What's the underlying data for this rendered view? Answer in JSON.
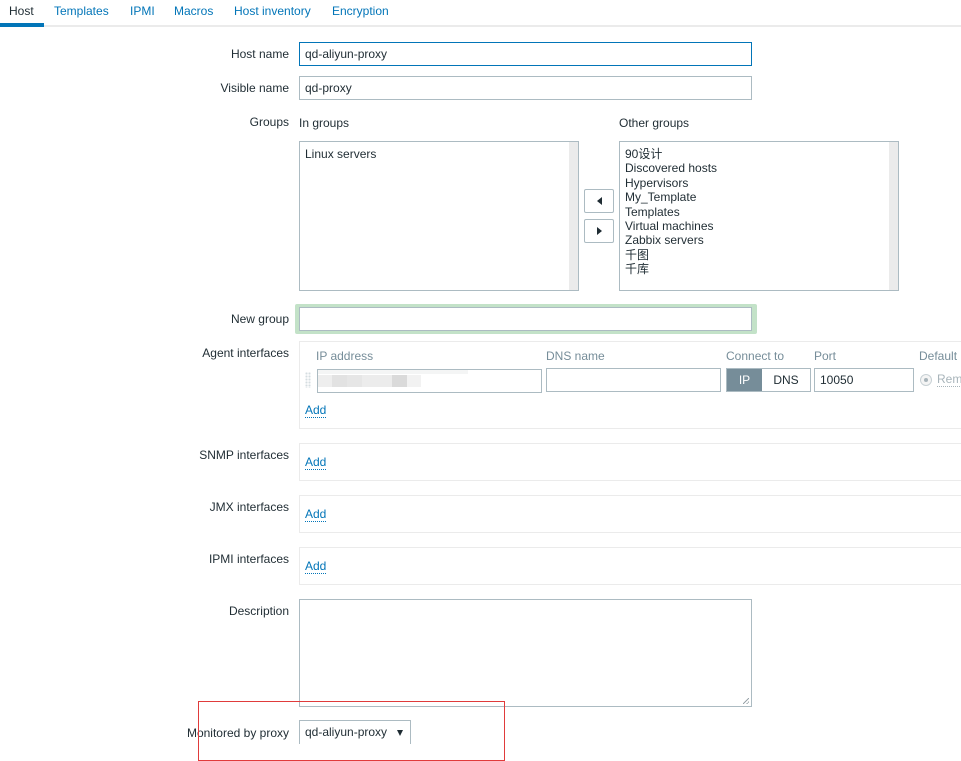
{
  "tabs": [
    {
      "label": "Host",
      "active": true
    },
    {
      "label": "Templates"
    },
    {
      "label": "IPMI"
    },
    {
      "label": "Macros"
    },
    {
      "label": "Host inventory"
    },
    {
      "label": "Encryption"
    }
  ],
  "form": {
    "host_name": {
      "label": "Host name",
      "value": "qd-aliyun-proxy"
    },
    "visible_name": {
      "label": "Visible name",
      "value": "qd-proxy"
    },
    "groups": {
      "label": "Groups",
      "in_groups_label": "In groups",
      "other_groups_label": "Other groups",
      "in_groups": [
        "Linux servers"
      ],
      "other_groups": [
        "90设计",
        "Discovered hosts",
        "Hypervisors",
        "My_Template",
        "Templates",
        "Virtual machines",
        "Zabbix servers",
        "千图",
        "千库"
      ],
      "move_left_icon": "triangle-left",
      "move_right_icon": "triangle-right"
    },
    "new_group": {
      "label": "New group",
      "value": ""
    },
    "agent_interfaces": {
      "label": "Agent interfaces",
      "columns": {
        "ip": "IP address",
        "dns": "DNS name",
        "connect": "Connect to",
        "port": "Port",
        "default": "Default"
      },
      "row": {
        "ip": "",
        "dns": "",
        "connect_options": [
          "IP",
          "DNS"
        ],
        "connect_selected": "IP",
        "port": "10050",
        "remove_label": "Rem"
      },
      "add_label": "Add"
    },
    "snmp_interfaces": {
      "label": "SNMP interfaces",
      "add_label": "Add"
    },
    "jmx_interfaces": {
      "label": "JMX interfaces",
      "add_label": "Add"
    },
    "ipmi_interfaces": {
      "label": "IPMI interfaces",
      "add_label": "Add"
    },
    "description": {
      "label": "Description",
      "value": ""
    },
    "monitored_by_proxy": {
      "label": "Monitored by proxy",
      "selected": "qd-aliyun-proxy"
    }
  },
  "colors": {
    "accent": "#0275b8",
    "text": "#1f2c33",
    "muted": "#768d99",
    "border": "#acbbc2",
    "annotation": "#e03b3b",
    "new_group_highlight": "#c3e2c8"
  }
}
